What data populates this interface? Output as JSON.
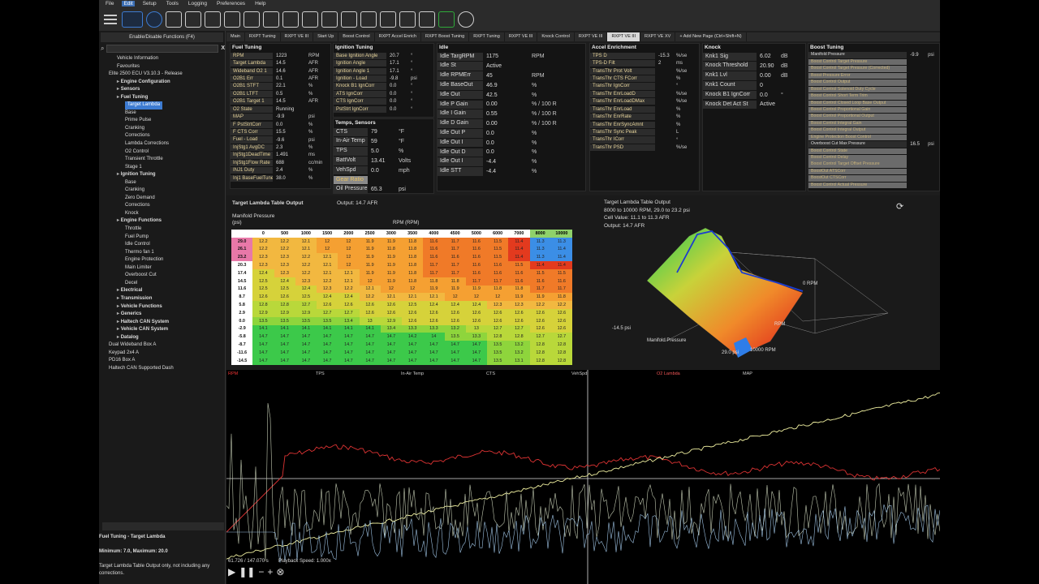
{
  "menu": [
    "File",
    "Edit",
    "Setup",
    "Tools",
    "Logging",
    "Preferences",
    "Help"
  ],
  "sidebar": {
    "title": "Enable/Disable Functions (F4)",
    "tree": [
      {
        "label": "Vehicle Information",
        "lvl": 1,
        "b": false
      },
      {
        "label": "Favourites",
        "lvl": 1,
        "b": false
      },
      {
        "label": "Elite 2500 ECU V3.10.3 - Release",
        "lvl": 0,
        "b": false
      },
      {
        "label": "Engine Configuration",
        "lvl": 1,
        "b": true
      },
      {
        "label": "Sensors",
        "lvl": 1,
        "b": true
      },
      {
        "label": "Fuel Tuning",
        "lvl": 1,
        "b": true
      },
      {
        "label": "Target Lambda",
        "lvl": 2,
        "b": false,
        "sel": true
      },
      {
        "label": "Base",
        "lvl": 2,
        "b": false
      },
      {
        "label": "Prime Pulse",
        "lvl": 2,
        "b": false
      },
      {
        "label": "Cranking",
        "lvl": 2,
        "b": false
      },
      {
        "label": "Corrections",
        "lvl": 2,
        "b": false
      },
      {
        "label": "Lambda Corrections",
        "lvl": 2,
        "b": false
      },
      {
        "label": "O2 Control",
        "lvl": 2,
        "b": false
      },
      {
        "label": "Transient Throttle",
        "lvl": 2,
        "b": false
      },
      {
        "label": "Stage 1",
        "lvl": 2,
        "b": false
      },
      {
        "label": "Ignition Tuning",
        "lvl": 1,
        "b": true
      },
      {
        "label": "Base",
        "lvl": 2,
        "b": false
      },
      {
        "label": "Cranking",
        "lvl": 2,
        "b": false
      },
      {
        "label": "Zero Demand",
        "lvl": 2,
        "b": false
      },
      {
        "label": "Corrections",
        "lvl": 2,
        "b": false
      },
      {
        "label": "Knock",
        "lvl": 2,
        "b": false
      },
      {
        "label": "Engine Functions",
        "lvl": 1,
        "b": true
      },
      {
        "label": "Throttle",
        "lvl": 2,
        "b": false
      },
      {
        "label": "Fuel Pump",
        "lvl": 2,
        "b": false
      },
      {
        "label": "Idle Control",
        "lvl": 2,
        "b": false
      },
      {
        "label": "Thermo fan 1",
        "lvl": 2,
        "b": false
      },
      {
        "label": "Engine Protection",
        "lvl": 2,
        "b": false
      },
      {
        "label": "Main Limiter",
        "lvl": 2,
        "b": false
      },
      {
        "label": "Overboost Cut",
        "lvl": 2,
        "b": false
      },
      {
        "label": "Decel",
        "lvl": 2,
        "b": false
      },
      {
        "label": "Electrical",
        "lvl": 1,
        "b": true
      },
      {
        "label": "Transmission",
        "lvl": 1,
        "b": true
      },
      {
        "label": "Vehicle Functions",
        "lvl": 1,
        "b": true
      },
      {
        "label": "Generics",
        "lvl": 1,
        "b": true
      },
      {
        "label": "Haltech CAN System",
        "lvl": 1,
        "b": true
      },
      {
        "label": "Vehicle CAN System",
        "lvl": 1,
        "b": true
      },
      {
        "label": "Datalog",
        "lvl": 1,
        "b": true
      },
      {
        "label": "Dual Wideband Box A",
        "lvl": 0,
        "b": false
      },
      {
        "label": "Keypad 2x4 A",
        "lvl": 0,
        "b": false
      },
      {
        "label": "PD16 Box A",
        "lvl": 0,
        "b": false
      },
      {
        "label": "Haltech CAN Supported Dash",
        "lvl": 0,
        "b": false
      }
    ],
    "help_title": "Fuel Tuning - Target Lambda",
    "help_minmax": "Minimum: 7.0, Maximum: 20.0",
    "help_text": "Target Lambda Table Output only, not including any corrections."
  },
  "tabs": [
    "Main",
    "RXPT Tuning",
    "RXPT VE III",
    "Start Up",
    "Boost Control",
    "RXPT Accel Enrich",
    "RXPT Boost Tuning",
    "RXPT Tuning",
    "RXPT VE III",
    "Knock Control",
    "RXPT VE III",
    "RXPT VE III",
    "RXPT VE XV",
    "+ Add New Page (Ctrl+Shift+N)"
  ],
  "active_tab": 11,
  "fuel_tuning": {
    "title": "Fuel Tuning",
    "rows": [
      [
        "RPM",
        "1223",
        "RPM"
      ],
      [
        "Target Lambda",
        "14.5",
        "AFR"
      ],
      [
        "Wideband O2 1",
        "14.6",
        "AFR"
      ],
      [
        "O2B1 Err",
        "0.1",
        "AFR"
      ],
      [
        "O2B1 STFT",
        "22.1",
        "%"
      ],
      [
        "O2B1 LTFT",
        "0.5",
        "%"
      ],
      [
        "O2B1 Target 1",
        "14.5",
        "AFR"
      ],
      [
        "O2 State",
        "Running",
        ""
      ],
      [
        "MAP",
        "-9.9",
        "psi"
      ],
      [
        "F PstStrtCorr",
        "0.0",
        "%"
      ],
      [
        "F CTS Corr",
        "15.5",
        "%"
      ],
      [
        "Fuel - Load",
        "-9.6",
        "psi"
      ],
      [
        "InjStg1 AvgDC",
        "2.3",
        "%"
      ],
      [
        "InjStg1DeadTime",
        "1.491",
        "ms"
      ],
      [
        "InjStg1Flow Rate",
        "688",
        "cc/min"
      ],
      [
        "INJ1 Duty",
        "2.4",
        "%"
      ],
      [
        "Inj1 BaseFuelTune",
        "38.0",
        "%"
      ]
    ]
  },
  "ignition_tuning": {
    "title": "Ignition Tuning",
    "rows": [
      [
        "Base Ignition Angle",
        "20.7",
        "°"
      ],
      [
        "Ignition Angle",
        "17.1",
        "°"
      ],
      [
        "Ignition Angle 1",
        "17.1",
        "°"
      ],
      [
        "Ignition - Load",
        "-9.8",
        "psi"
      ],
      [
        "Knock B1 IgnCorr",
        "0.0",
        "°"
      ],
      [
        "ATS IgnCorr",
        "0.0",
        "°"
      ],
      [
        "CTS IgnCorr",
        "0.0",
        "°"
      ],
      [
        "PstStrt IgnCorr",
        "0.0",
        "°"
      ]
    ]
  },
  "temps": {
    "title": "Temps, Sensors",
    "rows": [
      [
        "CTS",
        "79",
        "°F"
      ],
      [
        "In-Air Temp",
        "59",
        "°F"
      ],
      [
        "TPS",
        "5.0",
        "%"
      ],
      [
        "BattVolt",
        "13.41",
        "Volts"
      ],
      [
        "VehSpd",
        "0.0",
        "mph"
      ],
      [
        "Gear Ratio",
        "",
        ""
      ],
      [
        "Oil Pressure",
        "65.3",
        "psi"
      ]
    ]
  },
  "idle": {
    "title": "Idle",
    "rows": [
      [
        "Idle TargRPM",
        "1175",
        "RPM"
      ],
      [
        "Idle St",
        "Active",
        ""
      ],
      [
        "Idle RPMErr",
        "45",
        "RPM"
      ],
      [
        "Idle BaseOut",
        "46.9",
        "%"
      ],
      [
        "Idle Out",
        "42.5",
        "%"
      ],
      [
        "Idle P Gain",
        "0.00",
        "% / 100 R"
      ],
      [
        "Idle I Gain",
        "0.55",
        "% / 100 R"
      ],
      [
        "Idle D Gain",
        "0.00",
        "% / 100 R"
      ],
      [
        "Idle Out P",
        "0.0",
        "%"
      ],
      [
        "Idle Out I",
        "0.0",
        "%"
      ],
      [
        "Idle Out D",
        "0.0",
        "%"
      ],
      [
        "Idle Out I",
        "-4.4",
        "%"
      ],
      [
        "Idle STT",
        "-4.4",
        "%"
      ]
    ]
  },
  "accel": {
    "title": "Accel Enrichment",
    "rows": [
      [
        "TPS D",
        "-15.3",
        "%/se"
      ],
      [
        "TPS-D Filt",
        "2",
        "ms"
      ],
      [
        "TransThr Prot Volt",
        "",
        "%/se"
      ],
      [
        "TransThr CTS FCorr",
        "",
        "%"
      ],
      [
        "TransThr IgnCorr",
        "",
        "°"
      ],
      [
        "TransThr EnrLoadD",
        "",
        "%/se"
      ],
      [
        "TransThr EnrLoadDMax",
        "",
        "%/se"
      ],
      [
        "TransThr EnrLoad",
        "",
        "%"
      ],
      [
        "TransThr EnrRate",
        "",
        "%"
      ],
      [
        "TransThr EnrSyncAmnt",
        "",
        "%"
      ],
      [
        "TransThr Sync Peak",
        "",
        "L"
      ],
      [
        "TransThr ICorr",
        "",
        "°"
      ],
      [
        "TransThr PSD",
        "",
        "%/se"
      ]
    ]
  },
  "knock": {
    "title": "Knock",
    "rows": [
      [
        "Knk1 Sig",
        "6.02",
        "dB"
      ],
      [
        "Knock Threshold",
        "20.90",
        "dB"
      ],
      [
        "Knk1 Lvl",
        "0.00",
        "dB"
      ],
      [
        "Knk1 Count",
        "0",
        ""
      ],
      [
        "Knock B1 IgnCorr",
        "0.0",
        "°"
      ],
      [
        "Knock Det Act St",
        "Active",
        ""
      ]
    ]
  },
  "boost": {
    "title": "Boost Tuning",
    "rows": [
      [
        "Manifold Pressure",
        "-9.9",
        "psi"
      ],
      [
        "Boost Control Target Pressure",
        "",
        ""
      ],
      [
        "Boost Control Target Pressure (Corrected)",
        "",
        ""
      ],
      [
        "Boost Pressure Error",
        "",
        ""
      ],
      [
        "Boost Control Output",
        "",
        ""
      ],
      [
        "Boost Control Solenoid Duty Cycle",
        "",
        ""
      ],
      [
        "Boost Control Short Term Trim",
        "",
        ""
      ],
      [
        "Boost Control Closed Loop Base Output",
        "",
        ""
      ],
      [
        "Boost Control Proportional Gain",
        "",
        ""
      ],
      [
        "Boost Control Proportional Output",
        "",
        ""
      ],
      [
        "Boost Control Integral Gain",
        "",
        ""
      ],
      [
        "Boost Control Integral Output",
        "",
        ""
      ],
      [
        "Engine Protection Boost Control",
        "",
        ""
      ],
      [
        "Overboost Cut Max Pressure",
        "16.5",
        "psi"
      ],
      [
        "Boost Control State",
        "",
        ""
      ],
      [
        "Boost Control Delay",
        "",
        ""
      ],
      [
        "Boost Control Target Offset Pressure",
        "",
        ""
      ],
      [
        "BoostOut ATSCorr",
        "",
        ""
      ],
      [
        "BoostOut CTSCorr",
        "",
        ""
      ],
      [
        "Boost Control Actual Pressure",
        "",
        ""
      ]
    ]
  },
  "table": {
    "title": "Target Lambda Table Output",
    "output": "Output: 14.7 AFR",
    "y_axis": "Manifold Pressure",
    "y_unit": "(psi)",
    "x_axis": "RPM (RPM)",
    "rpm": [
      "0",
      "500",
      "1000",
      "1500",
      "2000",
      "2500",
      "3000",
      "3500",
      "4000",
      "4500",
      "5000",
      "6000",
      "7000",
      "8000",
      "10000"
    ],
    "rows": [
      [
        "29.0",
        [
          12.2,
          12.2,
          12.1,
          12.0,
          12.0,
          11.9,
          11.9,
          11.8,
          11.6,
          11.7,
          11.6,
          11.5,
          11.4,
          11.3,
          11.3
        ]
      ],
      [
        "26.1",
        [
          12.2,
          12.2,
          12.1,
          12.0,
          12.0,
          11.9,
          11.8,
          11.8,
          11.6,
          11.7,
          11.6,
          11.5,
          11.4,
          11.3,
          11.4
        ]
      ],
      [
        "23.2",
        [
          12.3,
          12.3,
          12.2,
          12.1,
          12.0,
          11.9,
          11.9,
          11.8,
          11.6,
          11.6,
          11.6,
          11.5,
          11.4,
          11.3,
          11.4
        ]
      ],
      [
        "20.3",
        [
          12.3,
          12.3,
          12.2,
          12.1,
          12.0,
          11.9,
          11.9,
          11.8,
          11.7,
          11.7,
          11.6,
          11.6,
          11.5,
          11.4,
          11.4
        ]
      ],
      [
        "17.4",
        [
          12.4,
          12.3,
          12.2,
          12.1,
          12.1,
          11.9,
          11.9,
          11.8,
          11.7,
          11.7,
          11.6,
          11.6,
          11.6,
          11.5,
          11.5
        ]
      ],
      [
        "14.5",
        [
          12.5,
          12.4,
          12.3,
          12.2,
          12.1,
          12.0,
          11.9,
          11.8,
          11.8,
          11.8,
          11.7,
          11.7,
          11.6,
          11.6,
          11.6
        ]
      ],
      [
        "11.6",
        [
          12.5,
          12.5,
          12.4,
          12.3,
          12.2,
          12.1,
          12.0,
          12.0,
          11.9,
          11.9,
          11.9,
          11.8,
          11.8,
          11.7,
          11.7
        ]
      ],
      [
        "8.7",
        [
          12.6,
          12.6,
          12.5,
          12.4,
          12.4,
          12.2,
          12.1,
          12.1,
          12.1,
          12.0,
          12.0,
          12.0,
          11.9,
          11.9,
          11.8
        ]
      ],
      [
        "5.8",
        [
          12.8,
          12.8,
          12.7,
          12.6,
          12.6,
          12.6,
          12.6,
          12.5,
          12.4,
          12.4,
          12.4,
          12.3,
          12.3,
          12.2,
          12.2
        ]
      ],
      [
        "2.9",
        [
          12.9,
          12.9,
          12.9,
          12.7,
          12.7,
          12.6,
          12.6,
          12.6,
          12.6,
          12.6,
          12.6,
          12.6,
          12.6,
          12.6,
          12.6
        ]
      ],
      [
        "0.0",
        [
          13.5,
          13.5,
          13.5,
          13.5,
          13.4,
          13.0,
          12.9,
          12.6,
          12.6,
          12.6,
          12.6,
          12.6,
          12.6,
          12.6,
          12.6
        ]
      ],
      [
        "-2.9",
        [
          14.1,
          14.1,
          14.1,
          14.1,
          14.1,
          14.1,
          13.4,
          13.3,
          13.3,
          13.2,
          13.0,
          12.7,
          12.7,
          12.6,
          12.6
        ]
      ],
      [
        "-5.8",
        [
          14.7,
          14.7,
          14.7,
          14.7,
          14.7,
          14.7,
          14.7,
          14.2,
          14.0,
          13.5,
          13.3,
          12.8,
          12.8,
          12.7,
          12.7
        ]
      ],
      [
        "-8.7",
        [
          14.7,
          14.7,
          14.7,
          14.7,
          14.7,
          14.7,
          14.7,
          14.7,
          14.7,
          14.7,
          14.7,
          13.5,
          13.2,
          12.8,
          12.8
        ]
      ],
      [
        "-11.6",
        [
          14.7,
          14.7,
          14.7,
          14.7,
          14.7,
          14.7,
          14.7,
          14.7,
          14.7,
          14.7,
          14.7,
          13.5,
          13.2,
          12.8,
          12.8
        ]
      ],
      [
        "-14.5",
        [
          14.7,
          14.7,
          14.7,
          14.7,
          14.7,
          14.7,
          14.7,
          14.7,
          14.7,
          14.7,
          14.7,
          13.5,
          13.1,
          12.8,
          12.8
        ]
      ]
    ]
  },
  "surface": {
    "title": "Target Lambda Table Output",
    "range": "8000 to 10000 RPM, 29.0 to 23.2 psi",
    "cell": "Cell Value: 11.1 to 11.3 AFR",
    "output": "Output: 14.7 AFR",
    "lbl_rpm0": "0 RPM",
    "lbl_rpm": "RPM",
    "lbl_min": "-14.5 psi",
    "lbl_map": "Manifold Pressure",
    "lbl_max": "29.0 psi",
    "lbl_rpmmax": "10000 RPM"
  },
  "log": {
    "signals": [
      "RPM",
      "TPS",
      "In-Air Temp",
      "CTS",
      "VehSpd",
      "O2 Lambda",
      "MAP"
    ],
    "time": "61.726 / 147.070 s",
    "speed": "Playback Speed: 1.000x"
  },
  "colors": {
    "accent": "#3d7bd1",
    "panel": "#141414",
    "chrome": "#2b2b2b"
  }
}
